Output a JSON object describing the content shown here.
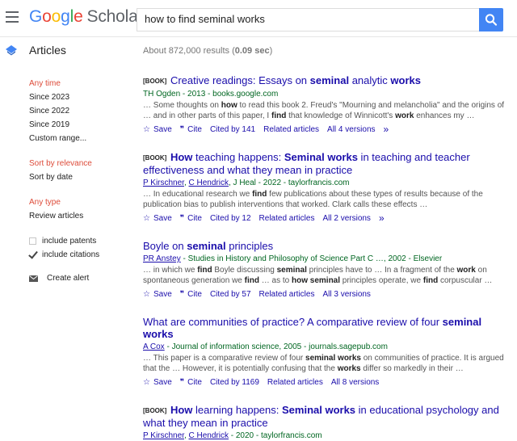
{
  "header": {
    "logo_google": [
      "G",
      "o",
      "o",
      "g",
      "l",
      "e"
    ],
    "logo_scholar": "Scholar",
    "search_query": "how to find seminal works"
  },
  "subbar": {
    "section_label": "Articles",
    "results_prefix": "About 872,000 results (",
    "results_time": "0.09 sec",
    "results_suffix": ")"
  },
  "sidebar": {
    "time_filters": [
      "Any time",
      "Since 2023",
      "Since 2022",
      "Since 2019",
      "Custom range..."
    ],
    "sort_options": [
      "Sort by relevance",
      "Sort by date"
    ],
    "type_options": [
      "Any type",
      "Review articles"
    ],
    "include_patents": "include patents",
    "include_citations": "include citations",
    "create_alert": "Create alert"
  },
  "results": [
    {
      "tag": "[BOOK]",
      "title_parts": [
        [
          "Creative readings: Essays on ",
          false
        ],
        [
          "seminal",
          true
        ],
        [
          " analytic ",
          false
        ],
        [
          "works",
          true
        ]
      ],
      "meta": "TH Ogden - 2013 - books.google.com",
      "snippet_parts": [
        [
          "… Some thoughts on ",
          false
        ],
        [
          "how",
          true
        ],
        [
          " to read this book 2. Freud's \"Mourning and melancholia\" and the origins of … and in other parts of this paper, I ",
          false
        ],
        [
          "find",
          true
        ],
        [
          " that knowledge of Winnicott's ",
          false
        ],
        [
          "work",
          true
        ],
        [
          " enhances my …",
          false
        ]
      ],
      "actions": [
        "Save",
        "Cite",
        "Cited by 141",
        "Related articles",
        "All 4 versions"
      ]
    },
    {
      "tag": "[BOOK]",
      "title_parts": [
        [
          "How",
          true
        ],
        [
          " teaching happens: ",
          false
        ],
        [
          "Seminal works",
          true
        ],
        [
          " in teaching and teacher effectiveness and what they mean in practice",
          false
        ]
      ],
      "authors": [
        "P Kirschner",
        "C Hendrick"
      ],
      "meta_rest": ", J Heal - 2022 - taylorfrancis.com",
      "snippet_parts": [
        [
          "… In educational research we ",
          false
        ],
        [
          "find",
          true
        ],
        [
          " few publications about these types of results because of the publication bias to publish interventions that worked. Clark calls these effects …",
          false
        ]
      ],
      "actions": [
        "Save",
        "Cite",
        "Cited by 12",
        "Related articles",
        "All 2 versions"
      ]
    },
    {
      "title_parts": [
        [
          "Boyle on ",
          false
        ],
        [
          "seminal",
          true
        ],
        [
          " principles",
          false
        ]
      ],
      "authors": [
        "PR Anstey"
      ],
      "meta_rest": " - Studies in History and Philosophy of Science Part C …, 2002 - Elsevier",
      "snippet_parts": [
        [
          "… in which we ",
          false
        ],
        [
          "find",
          true
        ],
        [
          " Boyle discussing ",
          false
        ],
        [
          "seminal",
          true
        ],
        [
          " principles have to … In a fragment of the ",
          false
        ],
        [
          "work",
          true
        ],
        [
          " on spontaneous generation we ",
          false
        ],
        [
          "find",
          true
        ],
        [
          " … as to ",
          false
        ],
        [
          "how seminal",
          true
        ],
        [
          " principles operate, we ",
          false
        ],
        [
          "find",
          true
        ],
        [
          " corpuscular …",
          false
        ]
      ],
      "actions": [
        "Save",
        "Cite",
        "Cited by 57",
        "Related articles",
        "All 3 versions"
      ]
    },
    {
      "title_parts": [
        [
          "What are communities of practice? A comparative review of four ",
          false
        ],
        [
          "seminal works",
          true
        ]
      ],
      "authors": [
        "A Cox"
      ],
      "meta_rest": " - Journal of information science, 2005 - journals.sagepub.com",
      "snippet_parts": [
        [
          "… This paper is a comparative review of four ",
          false
        ],
        [
          "seminal works",
          true
        ],
        [
          " on communities of practice. It is argued that the … However, it is potentially confusing that the ",
          false
        ],
        [
          "works",
          true
        ],
        [
          " differ so markedly in their …",
          false
        ]
      ],
      "actions": [
        "Save",
        "Cite",
        "Cited by 1169",
        "Related articles",
        "All 8 versions"
      ]
    },
    {
      "tag": "[BOOK]",
      "title_parts": [
        [
          "How",
          true
        ],
        [
          " learning happens: ",
          false
        ],
        [
          "Seminal works",
          true
        ],
        [
          " in educational psychology and what they mean in practice",
          false
        ]
      ],
      "authors": [
        "P Kirschner",
        "C Hendrick"
      ],
      "meta_rest": " - 2020 - taylorfrancis.com",
      "snippet_parts": [],
      "actions": []
    }
  ],
  "colors": {
    "link": "#1a0dab",
    "green": "#006621",
    "accent_red": "#dd4b39",
    "search_button": "#4285f4"
  }
}
